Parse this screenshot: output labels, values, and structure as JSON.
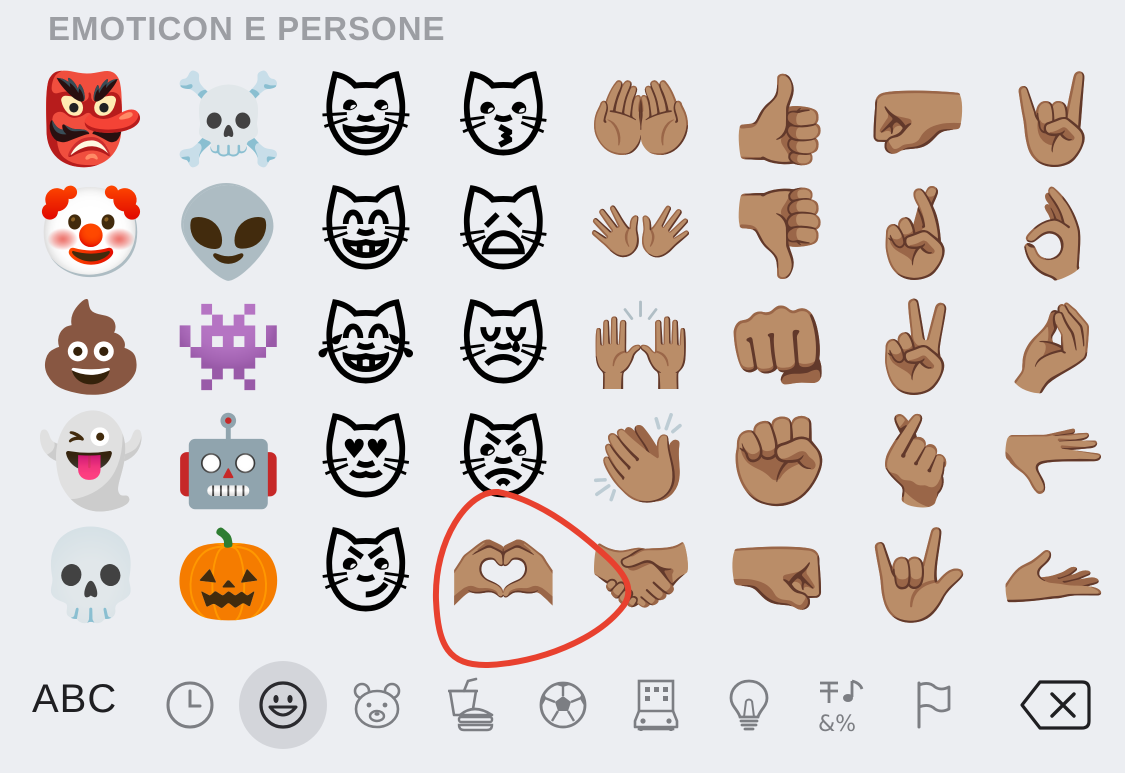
{
  "section": {
    "title": "EMOTICON E PERSONE"
  },
  "emoji_rows": [
    [
      "👺",
      "☠️",
      "😺",
      "😽",
      "🤲🏽",
      "👍🏽",
      "🤛🏽",
      "🤘🏽"
    ],
    [
      "🤡",
      "👽",
      "😸",
      "🙀",
      "👐🏽",
      "👎🏽",
      "🤞🏽",
      "👌🏽"
    ],
    [
      "💩",
      "👾",
      "😹",
      "😿",
      "🙌🏽",
      "👊🏽",
      "✌🏽",
      "🤌🏽"
    ],
    [
      "👻",
      "🤖",
      "😻",
      "😾",
      "👏🏽",
      "✊🏽",
      "🫰🏽",
      "🫳🏽"
    ],
    [
      "💀",
      "🎃",
      "😼",
      "🫶🏽",
      "🤝🏽",
      "🤜🏽",
      "🤟🏽",
      "🫴🏽"
    ]
  ],
  "annotation": {
    "color": "#e8412f"
  },
  "category_bar": {
    "abc_label": "ABC",
    "active_category": "smileys-and-people",
    "categories": [
      {
        "name": "recents",
        "icon": "clock-icon"
      },
      {
        "name": "smileys-and-people",
        "icon": "smiley-icon"
      },
      {
        "name": "animals-and-nature",
        "icon": "bear-icon"
      },
      {
        "name": "food-and-drink",
        "icon": "burger-drink-icon"
      },
      {
        "name": "activity",
        "icon": "soccer-ball-icon"
      },
      {
        "name": "travel-and-places",
        "icon": "building-car-icon"
      },
      {
        "name": "objects",
        "icon": "lightbulb-icon"
      },
      {
        "name": "symbols",
        "icon": "symbols-icon"
      },
      {
        "name": "flags",
        "icon": "flag-icon"
      }
    ],
    "delete_icon": "delete-backspace-icon"
  },
  "colors": {
    "background": "#eceef2",
    "title_gray": "#9c9ea3",
    "icon_gray": "#7c7e83",
    "active_bg": "#d3d5da"
  }
}
